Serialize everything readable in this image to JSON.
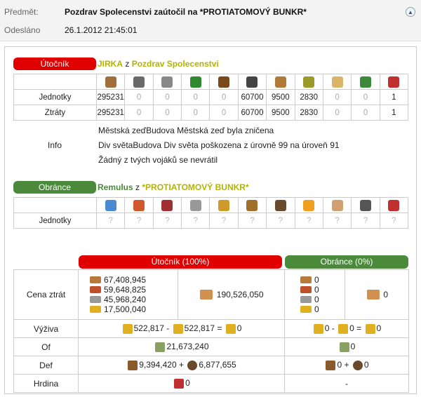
{
  "header": {
    "subject_label": "Předmět:",
    "subject": "Pozdrav Spolecenstvi zaútočil na *PROTIATOMOVÝ BUNKR*",
    "sent_label": "Odesláno",
    "sent": "26.1.2012 21:45:01"
  },
  "attacker": {
    "badge": "Útočník",
    "player": "JIRKA",
    "of": "z",
    "alliance": "Pozdrav Spolecenstvi",
    "unit_icons": [
      "club-icon",
      "spear-icon",
      "axe-icon",
      "boot-icon",
      "horse-icon",
      "knight-horse-icon",
      "ram-icon",
      "catapult-icon",
      "chief-icon",
      "settler-icon",
      "hero-icon"
    ],
    "units_label": "Jednotky",
    "units": [
      "295231",
      "0",
      "0",
      "0",
      "0",
      "60700",
      "9500",
      "2830",
      "0",
      "0",
      "1"
    ],
    "losses_label": "Ztráty",
    "losses": [
      "295231",
      "0",
      "0",
      "0",
      "0",
      "60700",
      "9500",
      "2830",
      "0",
      "0",
      "1"
    ],
    "info_label": "Info",
    "info": [
      "Městská zeďBudova Městská zeď byla zničena",
      "Div světaBudova Div světa poškozena z úrovně 99 na úroveň 91",
      "Žádný z tvých vojáků se nevrátil"
    ]
  },
  "defender": {
    "badge": "Obránce",
    "player": "Remulus",
    "of": "z",
    "alliance": "*PROTIATOMOVÝ BUNKR*",
    "unit_icons": [
      "sword-blue-icon",
      "sword-red-icon",
      "sword-dark-icon",
      "scout-horse-icon",
      "horse-icon",
      "knight-horse-icon",
      "ram-icon",
      "fire-catapult-icon",
      "senator-icon",
      "settler-icon",
      "hero-icon"
    ],
    "units_label": "Jednotky",
    "units": [
      "?",
      "?",
      "?",
      "?",
      "?",
      "?",
      "?",
      "?",
      "?",
      "?",
      "?"
    ]
  },
  "summary": {
    "att_header": "Útočník (100%)",
    "def_header": "Obránce (0%)",
    "loss_label": "Cena ztrát",
    "att_res": [
      "67,408,945",
      "59,648,825",
      "45,968,240",
      "17,500,040"
    ],
    "att_total": "190,526,050",
    "def_res": [
      "0",
      "0",
      "0",
      "0"
    ],
    "def_total": "0",
    "food_label": "Výživa",
    "att_food_a": "522,817",
    "att_food_minus": "-",
    "att_food_b": "522,817",
    "att_food_eq": "=",
    "att_food_c": "0",
    "def_food_a": "0",
    "def_food_minus": "-",
    "def_food_b": "0",
    "def_food_eq": "=",
    "def_food_c": "0",
    "off_label": "Of",
    "att_off": "21,673,240",
    "def_off": "0",
    "def_label": "Def",
    "att_def_a": "9,394,420",
    "att_def_plus": "+",
    "att_def_b": "6,877,655",
    "def_def_a": "0",
    "def_def_plus": "+",
    "def_def_b": "0",
    "hero_label": "Hrdina",
    "att_hero": "0",
    "def_hero": "-"
  },
  "colors": {
    "attacker": "#e00000",
    "defender": "#4a8a3a",
    "alliance": "#b3b300"
  }
}
